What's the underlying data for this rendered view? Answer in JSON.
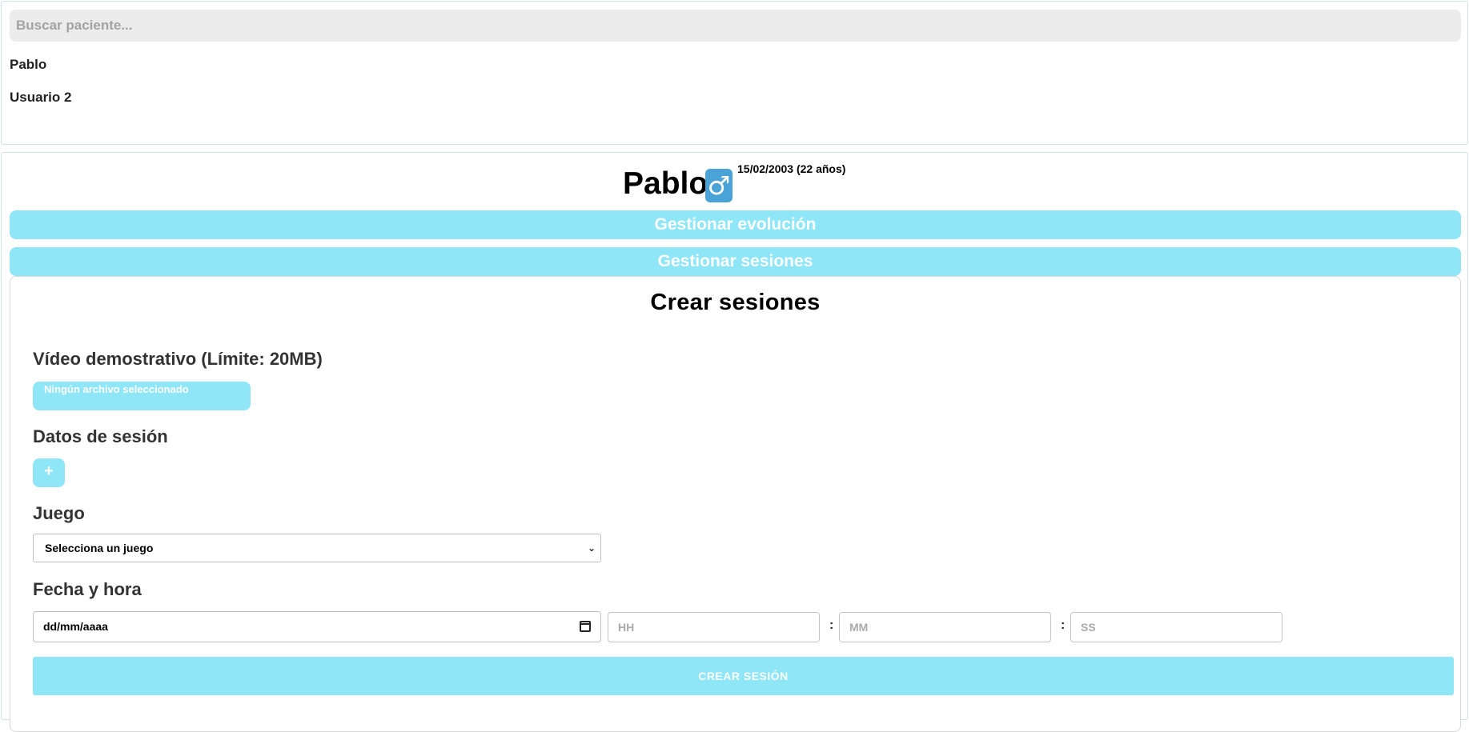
{
  "search": {
    "placeholder": "Buscar paciente..."
  },
  "patients": [
    {
      "name": "Pablo"
    },
    {
      "name": "Usuario 2"
    }
  ],
  "profile": {
    "name": "Pablo",
    "gender_symbol": "♂",
    "gender_icon": "male-icon",
    "dob_text": "15/02/2003 (22 años)"
  },
  "accordions": [
    {
      "label": "Gestionar evolución"
    },
    {
      "label": "Gestionar sesiones"
    }
  ],
  "form": {
    "title": "Crear sesiones",
    "video_label": "Vídeo demostrativo (Límite: 20MB)",
    "file_status": "Ningún archivo seleccionado",
    "datos_label": "Datos de sesión",
    "add_symbol": "+",
    "juego_label": "Juego",
    "juego_selected": "Selecciona un juego",
    "fecha_label": "Fecha y hora",
    "date_placeholder": "dd/mm/aaaa",
    "hh_placeholder": "HH",
    "mm_placeholder": "MM",
    "ss_placeholder": "SS",
    "separator": ":",
    "submit_label": "CREAR SESIÓN"
  },
  "colors": {
    "accent": "#8ee6f7",
    "badge": "#4aa3d6",
    "search_bg": "#ececec"
  }
}
